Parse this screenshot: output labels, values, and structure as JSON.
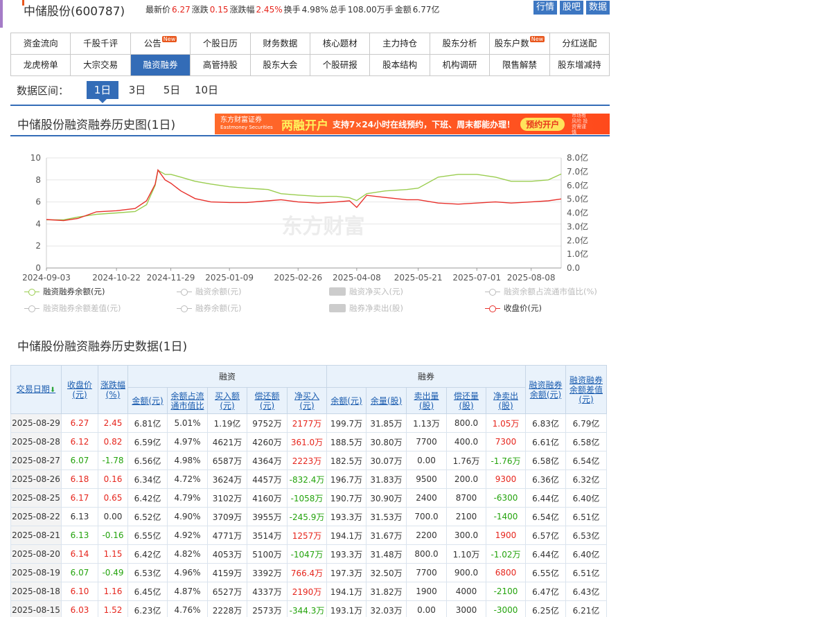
{
  "header": {
    "stock_title": "中储股份(600787)",
    "quotes": [
      {
        "label": "最新价",
        "value": "6.27",
        "color": "red"
      },
      {
        "label": "涨跌",
        "value": "0.15",
        "color": "red"
      },
      {
        "label": "涨跌幅",
        "value": "2.45%",
        "color": "red"
      },
      {
        "label": "换手",
        "value": "4.98%",
        "color": "black"
      },
      {
        "label": "总手",
        "value": "108.00万手",
        "color": "black"
      },
      {
        "label": "金额",
        "value": "6.77亿",
        "color": "black"
      }
    ],
    "buttons": [
      "行情",
      "股吧",
      "数据"
    ]
  },
  "nav": {
    "row1": [
      {
        "label": "资金流向"
      },
      {
        "label": "千股千评"
      },
      {
        "label": "公告",
        "badge": "New"
      },
      {
        "label": "个股日历"
      },
      {
        "label": "财务数据"
      },
      {
        "label": "核心题材"
      },
      {
        "label": "主力持仓"
      },
      {
        "label": "股东分析"
      },
      {
        "label": "股东户数",
        "badge": "New"
      },
      {
        "label": "分红送配"
      }
    ],
    "row2": [
      {
        "label": "龙虎榜单"
      },
      {
        "label": "大宗交易"
      },
      {
        "label": "融资融券",
        "active": true
      },
      {
        "label": "高管持股"
      },
      {
        "label": "股东大会"
      },
      {
        "label": "个股研报"
      },
      {
        "label": "股本结构"
      },
      {
        "label": "机构调研"
      },
      {
        "label": "限售解禁"
      },
      {
        "label": "股东增减持"
      }
    ]
  },
  "range": {
    "label": "数据区间：",
    "options": [
      "1日",
      "3日",
      "5日",
      "10日"
    ],
    "selected": "1日"
  },
  "chart_section": {
    "title": "中储股份融资融券历史图(1日)",
    "ad": {
      "logo_line1": "东方财富证券",
      "logo_line2": "Eastmoney Securities",
      "headline": "两融开户",
      "text": "支持7×24小时在线预约，下班、周末都能办理！",
      "button": "预约开户",
      "note": "市场有风险 投资需谨慎"
    }
  },
  "chart_data": {
    "type": "line",
    "watermark": "东方财富",
    "x_ticks": [
      "2024-09-03",
      "2024-10-22",
      "2024-11-29",
      "2025-01-09",
      "2025-02-26",
      "2025-04-08",
      "2025-05-21",
      "2025-07-01",
      "2025-08-08"
    ],
    "x_range": [
      "2024-09-03",
      "2025-08-29"
    ],
    "y_left": {
      "min": 0,
      "max": 10,
      "ticks": [
        "0",
        "2",
        "4",
        "6",
        "8",
        "10"
      ]
    },
    "y_right": {
      "min": 0,
      "max": 8,
      "ticks": [
        "0.0",
        "1.0亿",
        "2.0亿",
        "3.0亿",
        "4.0亿",
        "5.0亿",
        "6.0亿",
        "7.0亿",
        "8.0亿"
      ]
    },
    "grid": "horizontal",
    "series": [
      {
        "name": "融资融券余额(元)",
        "axis": "right",
        "color": "#9acd4f",
        "points": [
          [
            "2024-09-03",
            3.5
          ],
          [
            "2024-09-15",
            3.5
          ],
          [
            "2024-09-25",
            3.7
          ],
          [
            "2024-10-08",
            3.9
          ],
          [
            "2024-10-22",
            4.0
          ],
          [
            "2024-11-04",
            4.1
          ],
          [
            "2024-11-12",
            4.6
          ],
          [
            "2024-11-18",
            6.0
          ],
          [
            "2024-11-20",
            7.1
          ],
          [
            "2024-11-25",
            6.8
          ],
          [
            "2024-11-29",
            6.8
          ],
          [
            "2024-12-06",
            6.6
          ],
          [
            "2024-12-16",
            6.3
          ],
          [
            "2024-12-27",
            6.1
          ],
          [
            "2025-01-09",
            5.9
          ],
          [
            "2025-01-21",
            5.8
          ],
          [
            "2025-02-05",
            5.7
          ],
          [
            "2025-02-14",
            5.4
          ],
          [
            "2025-02-26",
            5.3
          ],
          [
            "2025-03-12",
            5.2
          ],
          [
            "2025-03-25",
            5.2
          ],
          [
            "2025-04-03",
            5.1
          ],
          [
            "2025-04-08",
            4.9
          ],
          [
            "2025-04-15",
            5.4
          ],
          [
            "2025-04-28",
            5.6
          ],
          [
            "2025-05-13",
            5.7
          ],
          [
            "2025-05-21",
            5.8
          ],
          [
            "2025-06-04",
            6.6
          ],
          [
            "2025-06-18",
            6.8
          ],
          [
            "2025-07-01",
            6.8
          ],
          [
            "2025-07-14",
            6.6
          ],
          [
            "2025-07-25",
            6.3
          ],
          [
            "2025-08-08",
            6.3
          ],
          [
            "2025-08-20",
            6.4
          ],
          [
            "2025-08-29",
            6.83
          ]
        ]
      },
      {
        "name": "收盘价(元)",
        "axis": "left",
        "color": "#e8302b",
        "points": [
          [
            "2024-09-03",
            4.4
          ],
          [
            "2024-09-15",
            4.3
          ],
          [
            "2024-09-25",
            4.5
          ],
          [
            "2024-10-08",
            5.1
          ],
          [
            "2024-10-22",
            5.2
          ],
          [
            "2024-11-04",
            5.4
          ],
          [
            "2024-11-12",
            6.1
          ],
          [
            "2024-11-18",
            7.6
          ],
          [
            "2024-11-20",
            8.9
          ],
          [
            "2024-11-25",
            8.0
          ],
          [
            "2024-11-29",
            7.7
          ],
          [
            "2024-12-06",
            7.0
          ],
          [
            "2024-12-16",
            6.3
          ],
          [
            "2024-12-27",
            6.0
          ],
          [
            "2025-01-09",
            5.95
          ],
          [
            "2025-01-21",
            5.95
          ],
          [
            "2025-02-05",
            6.1
          ],
          [
            "2025-02-14",
            6.2
          ],
          [
            "2025-02-26",
            6.0
          ],
          [
            "2025-03-12",
            5.9
          ],
          [
            "2025-03-25",
            6.0
          ],
          [
            "2025-04-03",
            6.1
          ],
          [
            "2025-04-08",
            5.5
          ],
          [
            "2025-04-15",
            6.6
          ],
          [
            "2025-04-28",
            6.4
          ],
          [
            "2025-05-13",
            6.2
          ],
          [
            "2025-05-21",
            6.2
          ],
          [
            "2025-06-04",
            5.9
          ],
          [
            "2025-06-18",
            5.8
          ],
          [
            "2025-07-01",
            5.9
          ],
          [
            "2025-07-14",
            6.0
          ],
          [
            "2025-07-25",
            5.9
          ],
          [
            "2025-08-08",
            6.0
          ],
          [
            "2025-08-20",
            6.1
          ],
          [
            "2025-08-29",
            6.27
          ]
        ]
      }
    ],
    "legend": [
      {
        "name": "融资融券余额(元)",
        "style": "line",
        "active": true,
        "color": "#9acd4f"
      },
      {
        "name": "融资余额(元)",
        "style": "line",
        "active": false
      },
      {
        "name": "融资净买入(元)",
        "style": "bar",
        "active": false
      },
      {
        "name": "融资余额占流通市值比(%)",
        "style": "line",
        "active": false
      },
      {
        "name": "融资融券余额差值(元)",
        "style": "line",
        "active": false
      },
      {
        "name": "融券余额(元)",
        "style": "line",
        "active": false
      },
      {
        "name": "融券净卖出(股)",
        "style": "bar",
        "active": false
      },
      {
        "name": "收盘价(元)",
        "style": "line",
        "active": true,
        "color": "#e8302b"
      }
    ]
  },
  "table_section": {
    "title": "中储股份融资融券历史数据(1日)",
    "headers": {
      "date": "交易日期",
      "close": "收盘价(元)",
      "change": "涨跌幅(%)",
      "rz_group": "融资",
      "rz_cols": [
        "金额(元)",
        "余额占流通市值比",
        "买入额(元)",
        "偿还额(元)",
        "净买入(元)"
      ],
      "rq_group": "融券",
      "rq_cols": [
        "余额(元)",
        "余量(股)",
        "卖出量(股)",
        "偿还量(股)",
        "净卖出(股)"
      ],
      "total": "融资融券余额(元)",
      "diff": "融资融券余额差值(元)"
    },
    "rows": [
      [
        "2025-08-29",
        "6.27",
        "2.45",
        "6.81亿",
        "5.01%",
        "1.19亿",
        "9752万",
        "2177万",
        "199.7万",
        "31.85万",
        "1.13万",
        "800.0",
        "1.05万",
        "6.83亿",
        "6.79亿"
      ],
      [
        "2025-08-28",
        "6.12",
        "0.82",
        "6.59亿",
        "4.97%",
        "4621万",
        "4260万",
        "361.0万",
        "188.5万",
        "30.80万",
        "7700",
        "400.0",
        "7300",
        "6.61亿",
        "6.58亿"
      ],
      [
        "2025-08-27",
        "6.07",
        "-1.78",
        "6.56亿",
        "4.98%",
        "6587万",
        "4364万",
        "2223万",
        "182.5万",
        "30.07万",
        "0.00",
        "1.76万",
        "-1.76万",
        "6.58亿",
        "6.54亿"
      ],
      [
        "2025-08-26",
        "6.18",
        "0.16",
        "6.34亿",
        "4.72%",
        "3624万",
        "4457万",
        "-832.4万",
        "196.7万",
        "31.83万",
        "9500",
        "200.0",
        "9300",
        "6.36亿",
        "6.32亿"
      ],
      [
        "2025-08-25",
        "6.17",
        "0.65",
        "6.42亿",
        "4.79%",
        "3102万",
        "4160万",
        "-1058万",
        "190.7万",
        "30.90万",
        "2400",
        "8700",
        "-6300",
        "6.44亿",
        "6.40亿"
      ],
      [
        "2025-08-22",
        "6.13",
        "0.00",
        "6.52亿",
        "4.90%",
        "3709万",
        "3955万",
        "-245.9万",
        "193.3万",
        "31.53万",
        "700.0",
        "2100",
        "-1400",
        "6.54亿",
        "6.51亿"
      ],
      [
        "2025-08-21",
        "6.13",
        "-0.16",
        "6.55亿",
        "4.92%",
        "4771万",
        "3514万",
        "1257万",
        "194.1万",
        "31.67万",
        "2200",
        "300.0",
        "1900",
        "6.57亿",
        "6.53亿"
      ],
      [
        "2025-08-20",
        "6.14",
        "1.15",
        "6.42亿",
        "4.82%",
        "4053万",
        "5100万",
        "-1047万",
        "193.3万",
        "31.48万",
        "800.0",
        "1.10万",
        "-1.02万",
        "6.44亿",
        "6.40亿"
      ],
      [
        "2025-08-19",
        "6.07",
        "-0.49",
        "6.53亿",
        "4.96%",
        "4159万",
        "3392万",
        "766.4万",
        "197.3万",
        "32.50万",
        "7700",
        "900.0",
        "6800",
        "6.55亿",
        "6.51亿"
      ],
      [
        "2025-08-18",
        "6.10",
        "1.16",
        "6.45亿",
        "4.87%",
        "6527万",
        "4337万",
        "2190万",
        "194.1万",
        "31.82万",
        "1900",
        "4000",
        "-2100",
        "6.47亿",
        "6.43亿"
      ],
      [
        "2025-08-15",
        "6.03",
        "1.52",
        "6.23亿",
        "4.76%",
        "2228万",
        "2573万",
        "-344.3万",
        "193.1万",
        "32.03万",
        "0.00",
        "3000",
        "-3000",
        "6.25亿",
        "6.21亿"
      ]
    ]
  }
}
